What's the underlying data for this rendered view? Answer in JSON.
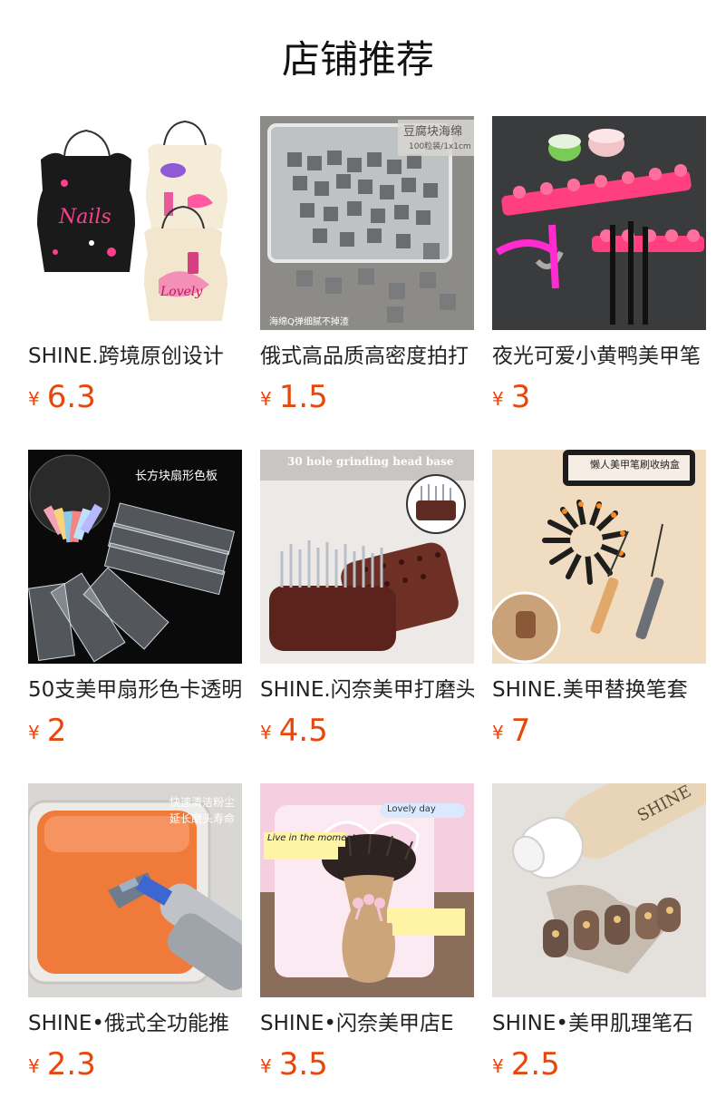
{
  "title": "店铺推荐",
  "currency": "¥",
  "colors": {
    "price": "#e8470c",
    "text": "#222222"
  },
  "products": [
    {
      "name": "SHINE.跨境原创设计",
      "price": "6.3",
      "image": "nail-aprons"
    },
    {
      "name": "俄式高品质高密度拍打",
      "price": "1.5",
      "image": "grey-sponge-cubes",
      "overlay": [
        "豆腐块海绵",
        "100粒装/1x1cm",
        "海绵Q弹细腻不掉渣"
      ]
    },
    {
      "name": "夜光可爱小黄鸭美甲笔",
      "price": "3",
      "image": "duck-pen-rack"
    },
    {
      "name": "50支美甲扇形色卡透明",
      "price": "2",
      "image": "fan-color-chart",
      "overlay": [
        "长方块扇形色板"
      ]
    },
    {
      "name": "SHINE.闪奈美甲打磨头",
      "price": "4.5",
      "image": "grinding-head-base",
      "overlay": [
        "30 hole grinding head base"
      ]
    },
    {
      "name": "SHINE.美甲替换笔套",
      "price": "7",
      "image": "brush-caps",
      "overlay": [
        "懒人美甲笔刷收纳盒"
      ]
    },
    {
      "name": "SHINE•俄式全功能推",
      "price": "2.3",
      "image": "orange-cleaning-gel",
      "overlay": [
        "快速清洁粉尘",
        "延长磨头寿命"
      ]
    },
    {
      "name": "SHINE•闪奈美甲店E",
      "price": "3.5",
      "image": "dust-brush",
      "overlay": [
        "Live in the moment",
        "Lovely day"
      ]
    },
    {
      "name": "SHINE•美甲肌理笔石",
      "price": "2.5",
      "image": "texture-pen",
      "overlay": [
        "SHINE"
      ]
    }
  ]
}
